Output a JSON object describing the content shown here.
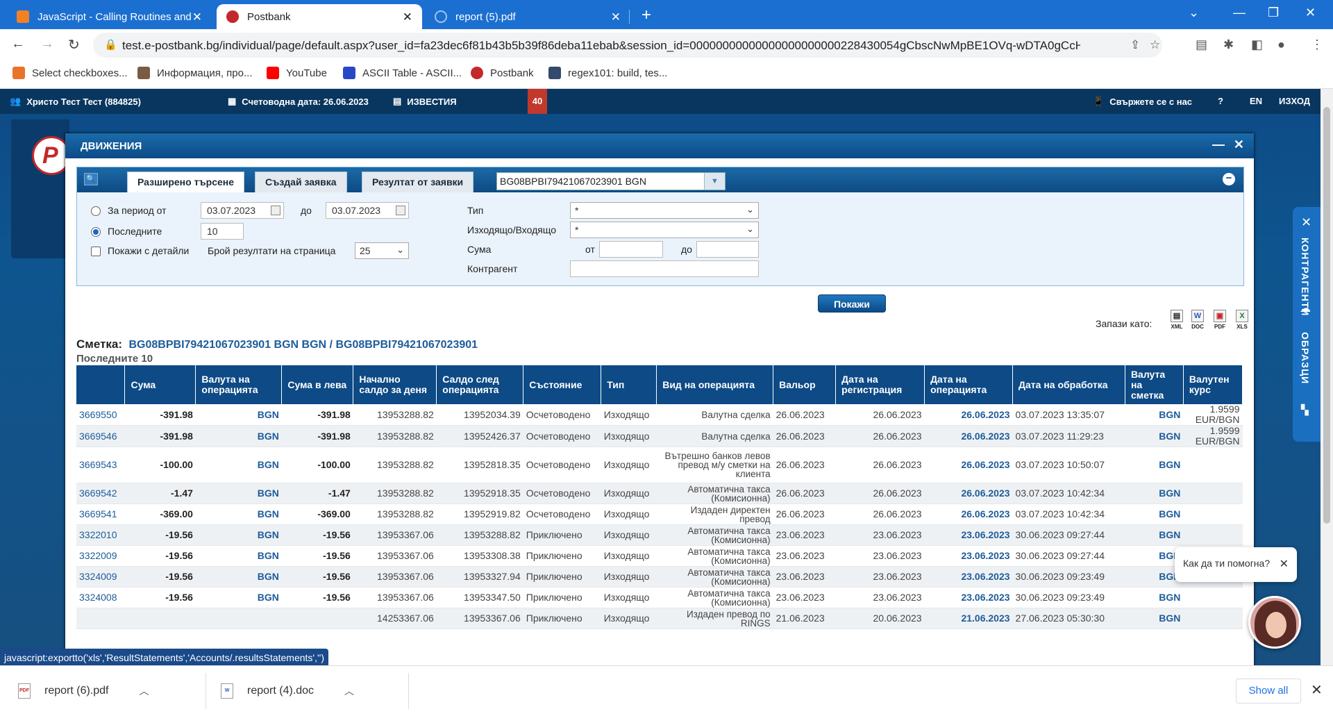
{
  "browser": {
    "tabs": [
      {
        "title": "JavaScript - Calling Routines and"
      },
      {
        "title": "Postbank"
      },
      {
        "title": "report (5).pdf"
      }
    ],
    "url": "test.e-postbank.bg/individual/page/default.aspx?user_id=fa23dec6f81b43b5b39f86deba11ebab&session_id=00000000000000000000000228430054gCbscNwMpBE1OVq-wDTA0gCcHbzj...",
    "bookmarks": [
      {
        "label": "Select checkboxes..."
      },
      {
        "label": "Информация, про..."
      },
      {
        "label": "YouTube"
      },
      {
        "label": "ASCII Table - ASCII..."
      },
      {
        "label": "Postbank"
      },
      {
        "label": "regex101: build, tes..."
      }
    ]
  },
  "site": {
    "user": "Христо Тест Тест (884825)",
    "accounting_date": "Счетоводна дата: 26.06.2023",
    "news": "ИЗВЕСТИЯ",
    "news_count": "40",
    "contact": "Свържете се с нас",
    "lang": "EN",
    "logout": "ИЗХОД"
  },
  "modal": {
    "title": "ДВИЖЕНИЯ",
    "tabs": [
      "Разширено търсене",
      "Създай заявка",
      "Резултат от заявки"
    ],
    "account_select": "BG08BPBI79421067023901  BGN",
    "filters": {
      "period_label": "За период от",
      "date_from": "03.07.2023",
      "to_label": "до",
      "date_to": "03.07.2023",
      "last_label": "Последните",
      "last_value": "10",
      "details_label": "Покажи с детайли",
      "per_page_label": "Брой резултати на страница",
      "per_page_value": "25",
      "type_label": "Тип",
      "type_value": "*",
      "direction_label": "Изходящо/Входящо",
      "direction_value": "*",
      "amount_label": "Сума",
      "amount_from_label": "от",
      "amount_to_label": "до",
      "counterparty_label": "Контрагент",
      "show_button": "Покажи"
    },
    "save_as": "Запази като:",
    "exports": [
      "XML",
      "DOC",
      "PDF",
      "XLS"
    ],
    "account_label": "Сметка:",
    "account_link": "BG08BPBI79421067023901 BGN  BGN /  BG08BPBI79421067023901",
    "last_n": "Последните 10",
    "table": {
      "headers": [
        "",
        "Сума",
        "Валута на операцията",
        "Сума в лева",
        "Начално салдо за деня",
        "Салдо след операцията",
        "Състояние",
        "Тип",
        "Вид на операцията",
        "Вальор",
        "Дата на регистрация",
        "Дата на операцията",
        "Дата на обработка",
        "Валута на сметка",
        "Валутен курс"
      ],
      "rows": [
        {
          "id": "3669550",
          "amount": "-391.98",
          "cur": "BGN",
          "bgn": "-391.98",
          "start": "13953288.82",
          "after": "13952034.39",
          "state": "Осчетоводено",
          "type": "Изходящо",
          "op": "Валутна сделка",
          "valor": "26.06.2023",
          "reg": "26.06.2023",
          "opdate": "26.06.2023",
          "proc": "03.07.2023 13:35:07",
          "acur": "BGN",
          "rate": "1.9599 EUR/BGN"
        },
        {
          "id": "3669546",
          "amount": "-391.98",
          "cur": "BGN",
          "bgn": "-391.98",
          "start": "13953288.82",
          "after": "13952426.37",
          "state": "Осчетоводено",
          "type": "Изходящо",
          "op": "Валутна сделка",
          "valor": "26.06.2023",
          "reg": "26.06.2023",
          "opdate": "26.06.2023",
          "proc": "03.07.2023 11:29:23",
          "acur": "BGN",
          "rate": "1.9599 EUR/BGN"
        },
        {
          "id": "3669543",
          "amount": "-100.00",
          "cur": "BGN",
          "bgn": "-100.00",
          "start": "13953288.82",
          "after": "13952818.35",
          "state": "Осчетоводено",
          "type": "Изходящо",
          "op": "Вътрешно банков левов превод м/у сметки на клиента",
          "valor": "26.06.2023",
          "reg": "26.06.2023",
          "opdate": "26.06.2023",
          "proc": "03.07.2023 10:50:07",
          "acur": "BGN",
          "rate": ""
        },
        {
          "id": "3669542",
          "amount": "-1.47",
          "cur": "BGN",
          "bgn": "-1.47",
          "start": "13953288.82",
          "after": "13952918.35",
          "state": "Осчетоводено",
          "type": "Изходящо",
          "op": "Автоматична такса (Комисионна)",
          "valor": "26.06.2023",
          "reg": "26.06.2023",
          "opdate": "26.06.2023",
          "proc": "03.07.2023 10:42:34",
          "acur": "BGN",
          "rate": ""
        },
        {
          "id": "3669541",
          "amount": "-369.00",
          "cur": "BGN",
          "bgn": "-369.00",
          "start": "13953288.82",
          "after": "13952919.82",
          "state": "Осчетоводено",
          "type": "Изходящо",
          "op": "Издаден директен превод",
          "valor": "26.06.2023",
          "reg": "26.06.2023",
          "opdate": "26.06.2023",
          "proc": "03.07.2023 10:42:34",
          "acur": "BGN",
          "rate": ""
        },
        {
          "id": "3322010",
          "amount": "-19.56",
          "cur": "BGN",
          "bgn": "-19.56",
          "start": "13953367.06",
          "after": "13953288.82",
          "state": "Приключено",
          "type": "Изходящо",
          "op": "Автоматична такса (Комисионна)",
          "valor": "23.06.2023",
          "reg": "23.06.2023",
          "opdate": "23.06.2023",
          "proc": "30.06.2023 09:27:44",
          "acur": "BGN",
          "rate": ""
        },
        {
          "id": "3322009",
          "amount": "-19.56",
          "cur": "BGN",
          "bgn": "-19.56",
          "start": "13953367.06",
          "after": "13953308.38",
          "state": "Приключено",
          "type": "Изходящо",
          "op": "Автоматична такса (Комисионна)",
          "valor": "23.06.2023",
          "reg": "23.06.2023",
          "opdate": "23.06.2023",
          "proc": "30.06.2023 09:27:44",
          "acur": "BGN",
          "rate": ""
        },
        {
          "id": "3324009",
          "amount": "-19.56",
          "cur": "BGN",
          "bgn": "-19.56",
          "start": "13953367.06",
          "after": "13953327.94",
          "state": "Приключено",
          "type": "Изходящо",
          "op": "Автоматична такса (Комисионна)",
          "valor": "23.06.2023",
          "reg": "23.06.2023",
          "opdate": "23.06.2023",
          "proc": "30.06.2023 09:23:49",
          "acur": "BGN",
          "rate": ""
        },
        {
          "id": "3324008",
          "amount": "-19.56",
          "cur": "BGN",
          "bgn": "-19.56",
          "start": "13953367.06",
          "after": "13953347.50",
          "state": "Приключено",
          "type": "Изходящо",
          "op": "Автоматична такса (Комисионна)",
          "valor": "23.06.2023",
          "reg": "23.06.2023",
          "opdate": "23.06.2023",
          "proc": "30.06.2023 09:23:49",
          "acur": "BGN",
          "rate": ""
        },
        {
          "id": "",
          "amount": "",
          "cur": "",
          "bgn": "",
          "start": "14253367.06",
          "after": "13953367.06",
          "state": "Приключено",
          "type": "Изходящо",
          "op": "Издаден превод по RINGS",
          "valor": "21.06.2023",
          "reg": "20.06.2023",
          "opdate": "21.06.2023",
          "proc": "27.06.2023 05:30:30",
          "acur": "BGN",
          "rate": ""
        }
      ]
    }
  },
  "side": {
    "contragents": "КОНТРАГЕНТИ",
    "templates": "ОБРАЗЦИ"
  },
  "chat": {
    "prompt": "Как да ти помогна?"
  },
  "status_url": "javascript:exportto('xls','ResultStatements','Accounts/.resultsStatements','')",
  "downloads": [
    {
      "name": "report (6).pdf",
      "kind": "PDF"
    },
    {
      "name": "report (4).doc",
      "kind": "W"
    }
  ],
  "show_all": "Show all"
}
